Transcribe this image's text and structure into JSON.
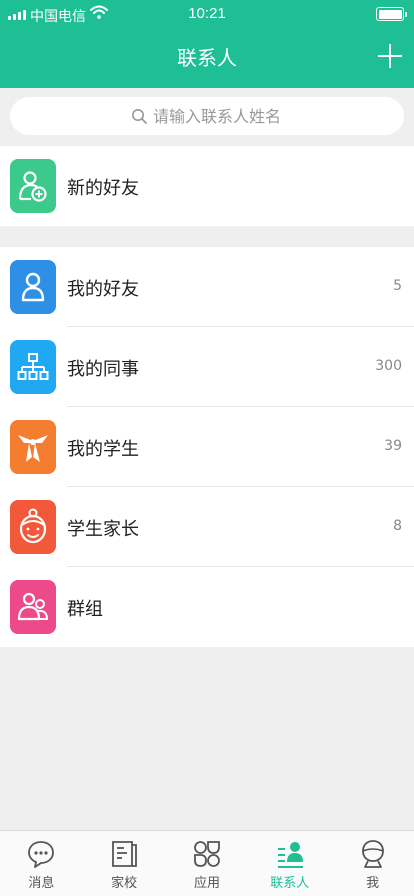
{
  "status_bar": {
    "carrier": "中国电信",
    "time": "10:21"
  },
  "nav": {
    "title": "联系人"
  },
  "search": {
    "placeholder": "请输入联系人姓名",
    "value": ""
  },
  "new_friends": {
    "label": "新的好友",
    "color": "#3cc98c"
  },
  "contacts": [
    {
      "label": "我的好友",
      "count": "5",
      "color": "#2d8fe6"
    },
    {
      "label": "我的同事",
      "count": "300",
      "color": "#21a8f2"
    },
    {
      "label": "我的学生",
      "count": "39",
      "color": "#f57d2f"
    },
    {
      "label": "学生家长",
      "count": "8",
      "color": "#f2583a"
    },
    {
      "label": "群组",
      "count": "",
      "color": "#ec4a8a"
    }
  ],
  "tabs": [
    {
      "label": "消息",
      "icon": "message-icon"
    },
    {
      "label": "家校",
      "icon": "book-icon"
    },
    {
      "label": "应用",
      "icon": "apps-icon"
    },
    {
      "label": "联系人",
      "icon": "contacts-icon",
      "active": true
    },
    {
      "label": "我",
      "icon": "profile-icon"
    }
  ],
  "colors": {
    "accent": "#1fbf96",
    "background": "#efefef"
  }
}
